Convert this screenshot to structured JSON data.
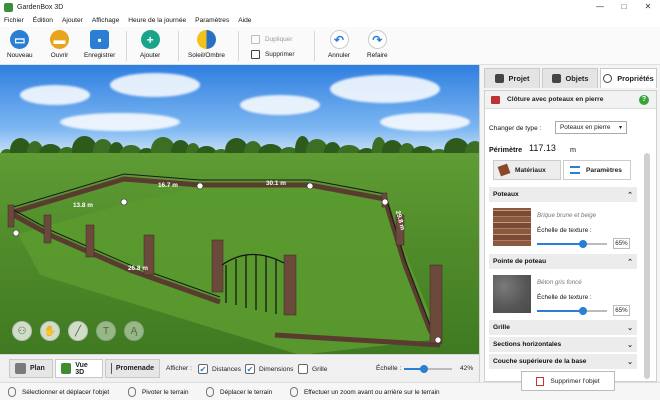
{
  "window": {
    "title": "GardenBox 3D",
    "controls": [
      "—",
      "□",
      "✕"
    ]
  },
  "menu": [
    "Fichier",
    "Édition",
    "Ajouter",
    "Affichage",
    "Heure de la journée",
    "Paramètres",
    "Aide"
  ],
  "toolbar": {
    "new": "Nouveau",
    "open": "Ouvrir",
    "save": "Enregistrer",
    "add": "Ajouter",
    "sun": "Soleil/Ombre",
    "duplicate": "Dupliquer",
    "delete": "Supprimer",
    "undo": "Annuler",
    "redo": "Refaire",
    "colors": {
      "new": "#2a7fd4",
      "open": "#e8a41c",
      "save": "#2a7fd4",
      "add": "#1aa58a",
      "undo": "#2a7fd4",
      "redo": "#2a7fd4"
    }
  },
  "scene": {
    "dimensions": [
      "13.8 m",
      "16.7 m",
      "30.1 m",
      "29.8 m",
      "26.8 m"
    ]
  },
  "viewbar": {
    "tabs": [
      "Plan",
      "Vue 3D",
      "Promenade"
    ],
    "display_label": "Afficher :",
    "distances": "Distances",
    "dimensions": "Dimensions",
    "grid": "Grille",
    "scale_label": "Échelle :",
    "scale_value": "42%",
    "scale_level": 0.42,
    "checked": {
      "distances": true,
      "dimensions": true,
      "grid": false
    }
  },
  "status": [
    "Sélectionner et déplacer l'objet",
    "Pivoter le terrain",
    "Déplacer le terrain",
    "Effectuer un zoom avant ou arrière sur le terrain"
  ],
  "panel": {
    "tabs": [
      "Projet",
      "Objets",
      "Propriétés"
    ],
    "object_title": "Clôture avec poteaux en pierre",
    "change_type_label": "Changer de type :",
    "type_value": "Poteaux en pierre",
    "perimeter_label": "Périmètre",
    "perimeter_value": "117.13",
    "perimeter_unit": "m",
    "materials_tab": "Matériaux",
    "params_tab": "Paramètres",
    "sections": {
      "posts": "Poteaux",
      "post_top": "Pointe de poteau",
      "grid": "Grille",
      "horizontal": "Sections horizontales",
      "top_layer": "Couche supérieure de la base"
    },
    "posts_material": "Brique brune et beige",
    "post_top_material": "Béton gris foncé",
    "texture_scale_label": "Échelle de texture :",
    "posts_scale": "65%",
    "post_top_scale": "65%",
    "posts_scale_level": 0.65,
    "post_top_scale_level": 0.65,
    "delete_button": "Supprimer l'objet",
    "help": "?"
  }
}
